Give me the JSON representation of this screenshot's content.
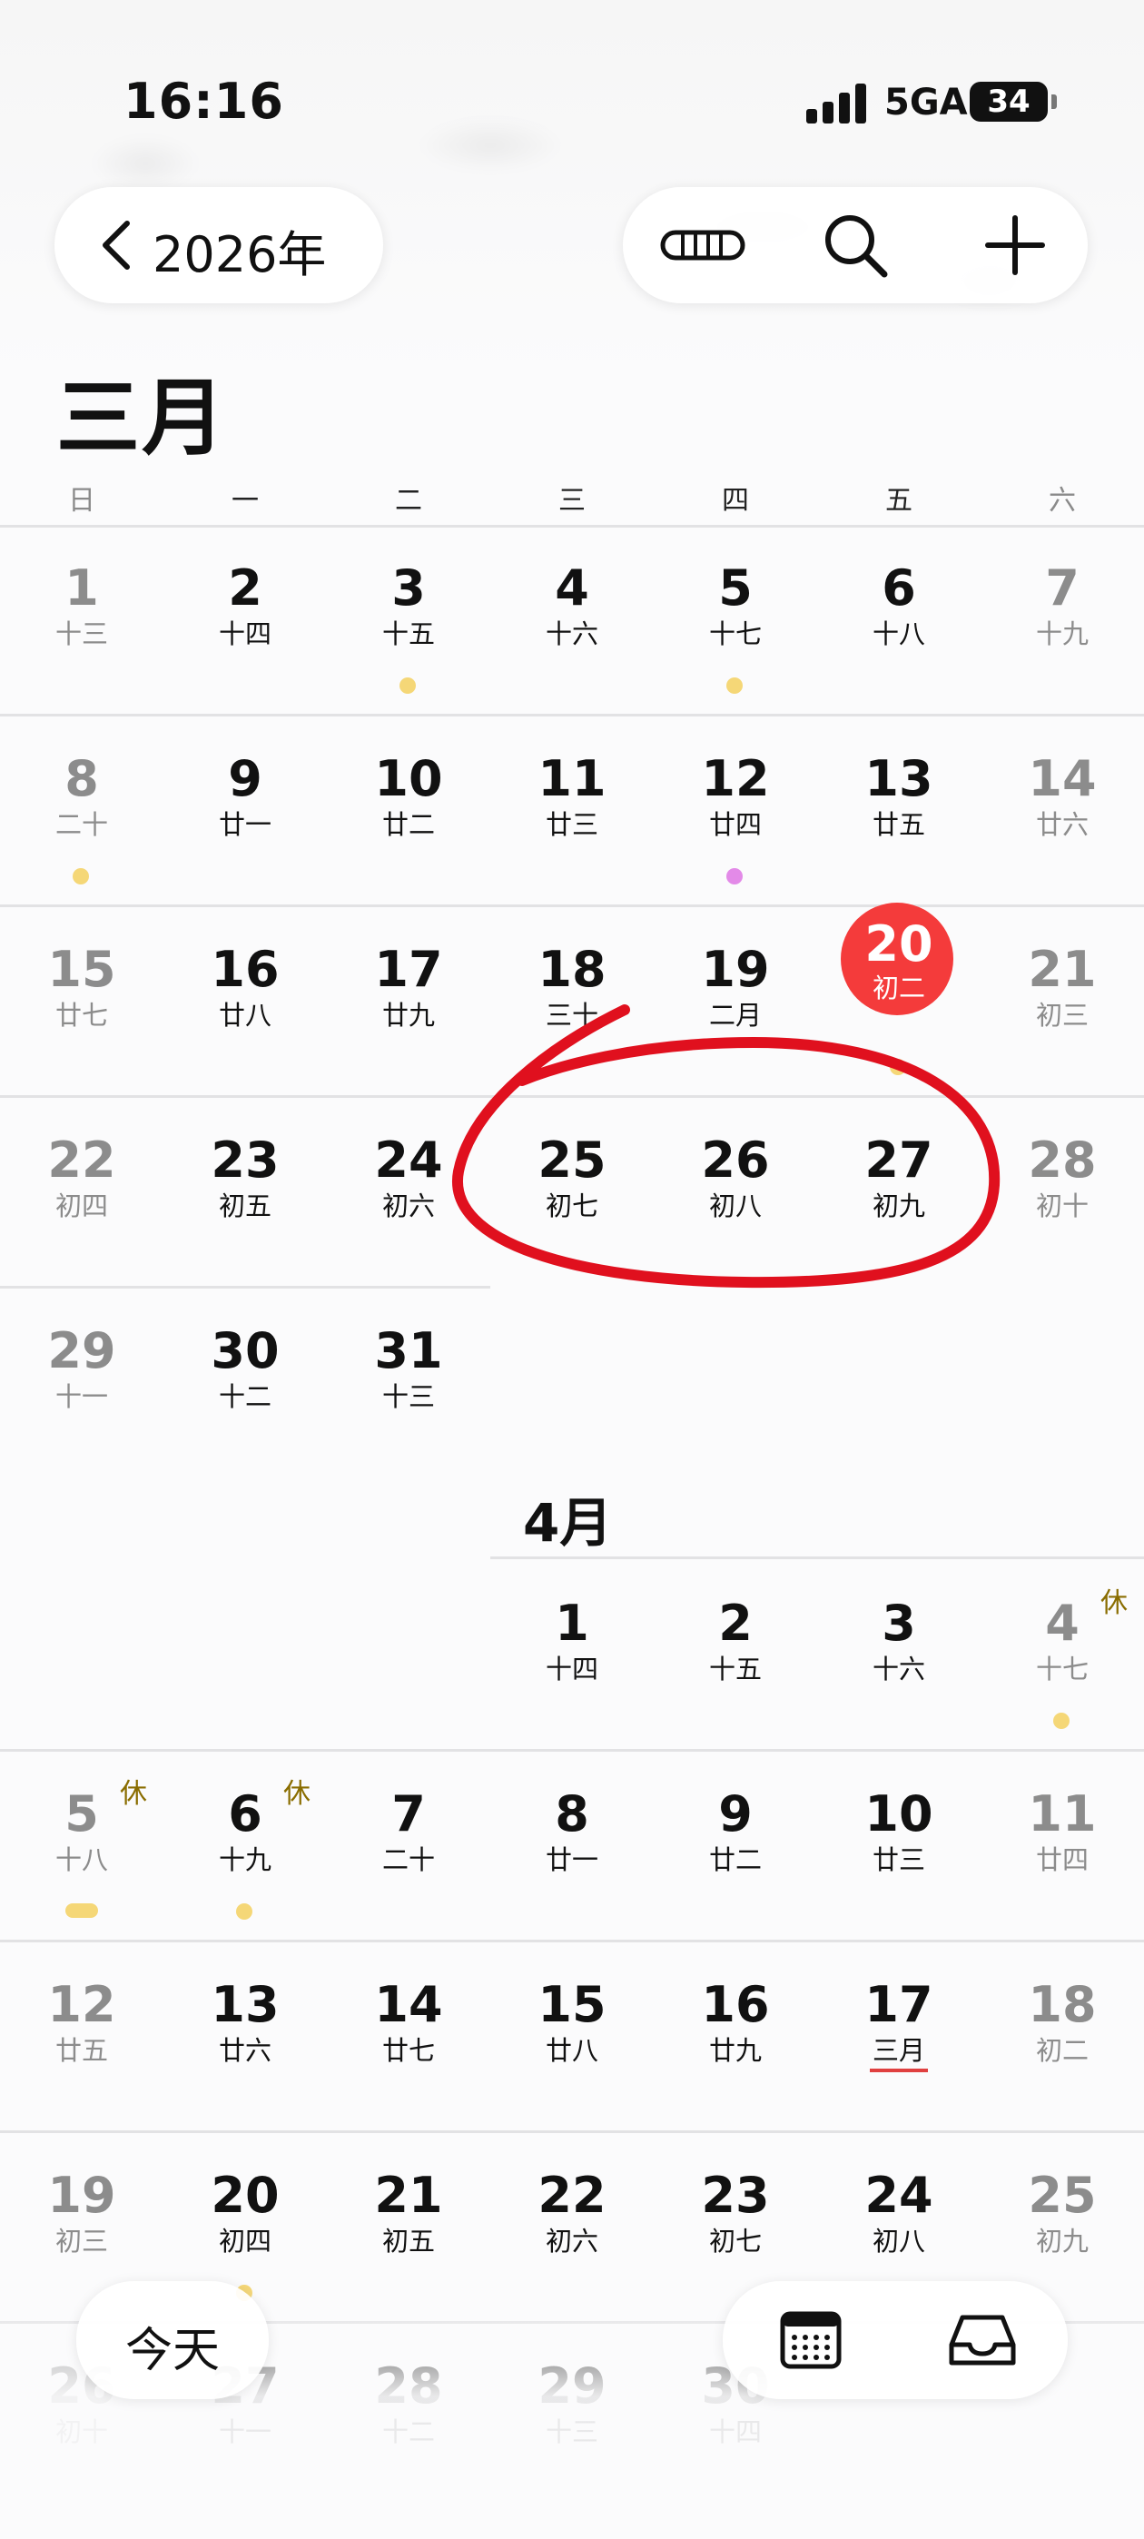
{
  "status_bar": {
    "time": "16:16",
    "network": "5GA",
    "battery": "34"
  },
  "header": {
    "year_label": "2026年",
    "month_title": "三月"
  },
  "weekdays": [
    "日",
    "一",
    "二",
    "三",
    "四",
    "五",
    "六"
  ],
  "march": {
    "rows": [
      [
        {
          "day": "1",
          "lunar": "十三"
        },
        {
          "day": "2",
          "lunar": "十四"
        },
        {
          "day": "3",
          "lunar": "十五",
          "dot": "yellow"
        },
        {
          "day": "4",
          "lunar": "十六"
        },
        {
          "day": "5",
          "lunar": "十七",
          "dot": "yellow"
        },
        {
          "day": "6",
          "lunar": "十八"
        },
        {
          "day": "7",
          "lunar": "十九"
        }
      ],
      [
        {
          "day": "8",
          "lunar": "二十",
          "dot": "yellow"
        },
        {
          "day": "9",
          "lunar": "廿一"
        },
        {
          "day": "10",
          "lunar": "廿二"
        },
        {
          "day": "11",
          "lunar": "廿三"
        },
        {
          "day": "12",
          "lunar": "廿四",
          "dot": "pink"
        },
        {
          "day": "13",
          "lunar": "廿五"
        },
        {
          "day": "14",
          "lunar": "廿六"
        }
      ],
      [
        {
          "day": "15",
          "lunar": "廿七"
        },
        {
          "day": "16",
          "lunar": "廿八"
        },
        {
          "day": "17",
          "lunar": "廿九"
        },
        {
          "day": "18",
          "lunar": "三十"
        },
        {
          "day": "19",
          "lunar": "二月"
        },
        {
          "day": "20",
          "lunar": "初二",
          "today": true,
          "dot": "yellow"
        },
        {
          "day": "21",
          "lunar": "初三"
        }
      ],
      [
        {
          "day": "22",
          "lunar": "初四"
        },
        {
          "day": "23",
          "lunar": "初五"
        },
        {
          "day": "24",
          "lunar": "初六"
        },
        {
          "day": "25",
          "lunar": "初七"
        },
        {
          "day": "26",
          "lunar": "初八"
        },
        {
          "day": "27",
          "lunar": "初九"
        },
        {
          "day": "28",
          "lunar": "初十"
        }
      ],
      [
        {
          "day": "29",
          "lunar": "十一"
        },
        {
          "day": "30",
          "lunar": "十二"
        },
        {
          "day": "31",
          "lunar": "十三"
        }
      ]
    ]
  },
  "april": {
    "label": "4月",
    "rows": [
      [
        {
          "day": "1",
          "lunar": "十四"
        },
        {
          "day": "2",
          "lunar": "十五"
        },
        {
          "day": "3",
          "lunar": "十六"
        },
        {
          "day": "4",
          "lunar": "十七",
          "rest": "休",
          "dot": "yellow"
        }
      ],
      [
        {
          "day": "5",
          "lunar": "十八",
          "rest": "休",
          "dot": "yellow-wide"
        },
        {
          "day": "6",
          "lunar": "十九",
          "rest": "休",
          "dot": "yellow"
        },
        {
          "day": "7",
          "lunar": "二十"
        },
        {
          "day": "8",
          "lunar": "廿一"
        },
        {
          "day": "9",
          "lunar": "廿二"
        },
        {
          "day": "10",
          "lunar": "廿三"
        },
        {
          "day": "11",
          "lunar": "廿四"
        }
      ],
      [
        {
          "day": "12",
          "lunar": "廿五"
        },
        {
          "day": "13",
          "lunar": "廿六"
        },
        {
          "day": "14",
          "lunar": "廿七"
        },
        {
          "day": "15",
          "lunar": "廿八"
        },
        {
          "day": "16",
          "lunar": "廿九"
        },
        {
          "day": "17",
          "lunar": "三月",
          "underline": true
        },
        {
          "day": "18",
          "lunar": "初二"
        }
      ],
      [
        {
          "day": "19",
          "lunar": "初三"
        },
        {
          "day": "20",
          "lunar": "初四",
          "dot": "yellow"
        },
        {
          "day": "21",
          "lunar": "初五"
        },
        {
          "day": "22",
          "lunar": "初六"
        },
        {
          "day": "23",
          "lunar": "初七"
        },
        {
          "day": "24",
          "lunar": "初八"
        },
        {
          "day": "25",
          "lunar": "初九"
        }
      ],
      [
        {
          "day": "26",
          "lunar": "初十"
        },
        {
          "day": "27",
          "lunar": "十一"
        },
        {
          "day": "28",
          "lunar": "十二"
        },
        {
          "day": "29",
          "lunar": "十三"
        },
        {
          "day": "30",
          "lunar": "十四"
        }
      ]
    ]
  },
  "bottom_bar": {
    "today_label": "今天"
  },
  "icons": [
    "chevron-left-icon",
    "view-toggle-icon",
    "search-icon",
    "plus-icon",
    "calendar-grid-icon",
    "inbox-icon"
  ],
  "colors": {
    "today": "#F43B3B",
    "event_yellow": "#F5D777",
    "event_pink": "#E38AE8",
    "annotation": "#E0101E"
  }
}
